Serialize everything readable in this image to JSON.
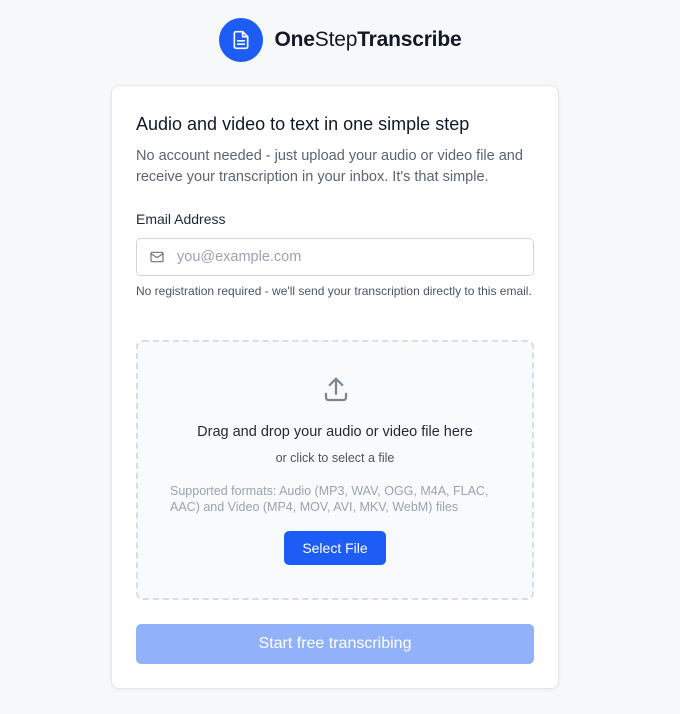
{
  "brand": {
    "name_part1": "One",
    "name_part2": "Step",
    "name_part3": "Transcribe",
    "logo_icon": "document-icon",
    "accent_color": "#1d5cf5"
  },
  "card": {
    "title": "Audio and video to text in one simple step",
    "subtitle": "No account needed - just upload your audio or video file and receive your transcription in your inbox. It's that simple.",
    "email": {
      "label": "Email Address",
      "placeholder": "you@example.com",
      "value": "",
      "icon": "mail-icon",
      "hint": "No registration required - we'll send your transcription directly to this email."
    },
    "dropzone": {
      "icon": "upload-icon",
      "title": "Drag and drop your audio or video file here",
      "subtitle": "or click to select a file",
      "formats": "Supported formats: Audio (MP3, WAV, OGG, M4A, FLAC, AAC) and Video (MP4, MOV, AVI, MKV, WebM) files",
      "button_label": "Select File"
    },
    "submit_label": "Start free transcribing",
    "submit_color": "#92b1fb"
  }
}
